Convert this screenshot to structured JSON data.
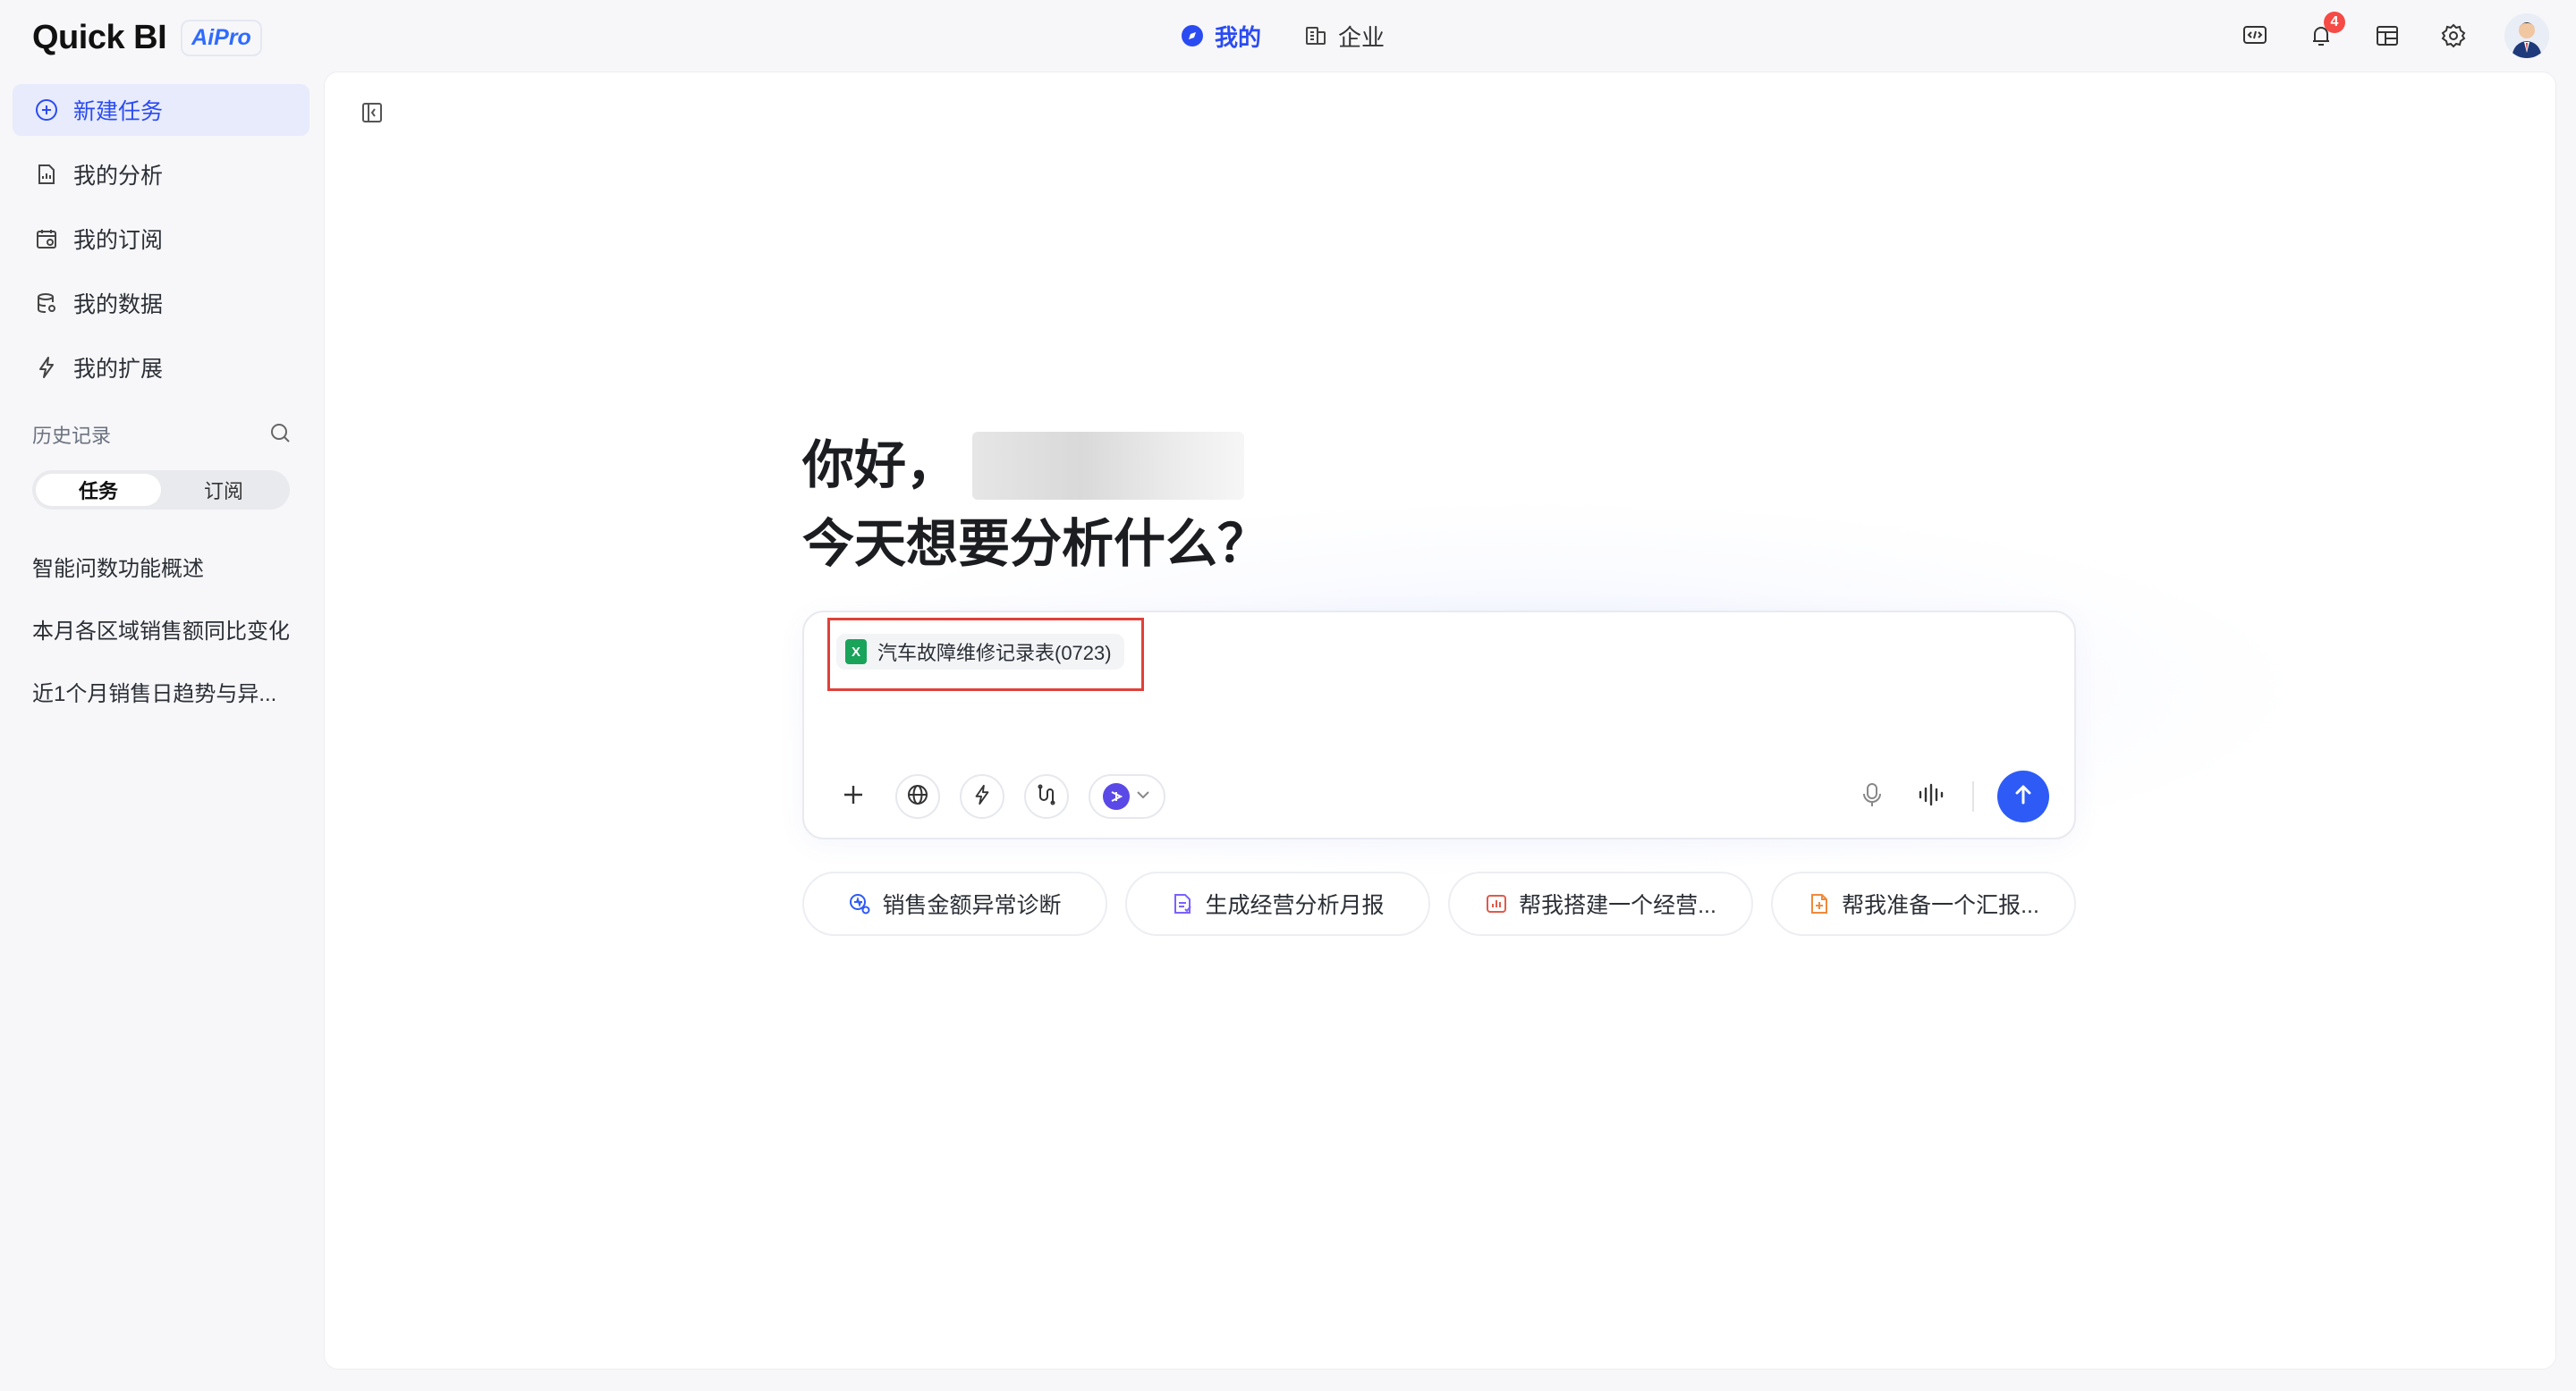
{
  "brand": {
    "name": "Quick BI",
    "badge": "AiPro"
  },
  "top_nav": {
    "tabs": [
      {
        "label": "我的",
        "active": true
      },
      {
        "label": "企业",
        "active": false
      }
    ]
  },
  "top_right": {
    "notification_count": "4"
  },
  "sidebar": {
    "menu": [
      {
        "label": "新建任务",
        "icon": "plus-circle-icon",
        "active": true
      },
      {
        "label": "我的分析",
        "icon": "document-chart-icon"
      },
      {
        "label": "我的订阅",
        "icon": "calendar-icon"
      },
      {
        "label": "我的数据",
        "icon": "database-icon"
      },
      {
        "label": "我的扩展",
        "icon": "lightning-icon"
      }
    ],
    "history_title": "历史记录",
    "segments": [
      {
        "label": "任务",
        "active": true
      },
      {
        "label": "订阅",
        "active": false
      }
    ],
    "history_items": [
      "智能问数功能概述",
      "本月各区域销售额同比变化",
      "近1个月销售日趋势与异..."
    ]
  },
  "main": {
    "greeting_line1": "你好，",
    "greeting_line2": "今天想要分析什么？",
    "attached_file": {
      "name": "汽车故障维修记录表(0723)",
      "icon_letter": "X"
    },
    "suggestions": [
      {
        "label": "销售金额异常诊断",
        "icon": "diagnosis-icon",
        "color": "#2e5bf6"
      },
      {
        "label": "生成经营分析月报",
        "icon": "report-icon",
        "color": "#7b61ff"
      },
      {
        "label": "帮我搭建一个经营...",
        "icon": "dashboard-icon",
        "color": "#e05a4a"
      },
      {
        "label": "帮我准备一个汇报...",
        "icon": "file-icon",
        "color": "#f08a3c"
      }
    ]
  },
  "colors": {
    "accent": "#2e5bf6",
    "highlight": "#e0403a",
    "excel": "#1aa35a"
  }
}
